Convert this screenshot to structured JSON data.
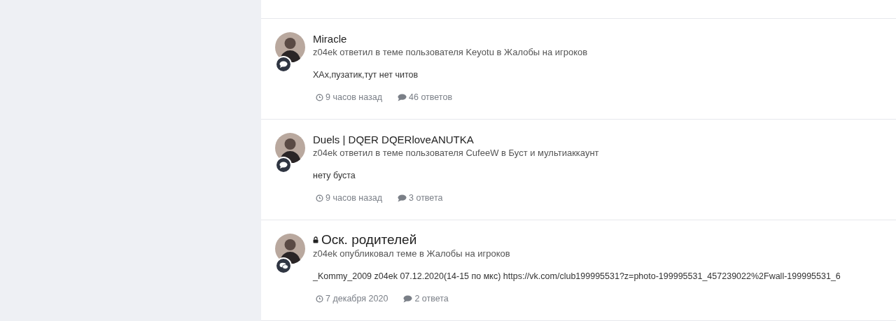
{
  "items": [
    {
      "kind": "reply",
      "locked": false,
      "title": "Miracle",
      "meta": "z04ek ответил в теме пользователя Keyotu в Жалобы на игроков",
      "snippet": "ХАх,пузатик,тут нет читов",
      "time": "9 часов назад",
      "replies": "46 ответов"
    },
    {
      "kind": "reply",
      "locked": false,
      "title": "Duels | DQER DQERloveANUTKA",
      "meta": "z04ek ответил в теме пользователя CufeeW в Буст и мультиаккаунт",
      "snippet": "нету буста",
      "time": "9 часов назад",
      "replies": "3 ответа"
    },
    {
      "kind": "topic",
      "locked": true,
      "title": "Оск. родителей",
      "meta": "z04ek опубликовал теме в Жалобы на игроков",
      "snippet": "_Kommy_2009 z04ek 07.12.2020(14-15 по мкс) https://vk.com/club199995531?z=photo-199995531_457239022%2Fwall-199995531_6",
      "time": "7 декабря 2020",
      "replies": "2 ответа"
    }
  ]
}
